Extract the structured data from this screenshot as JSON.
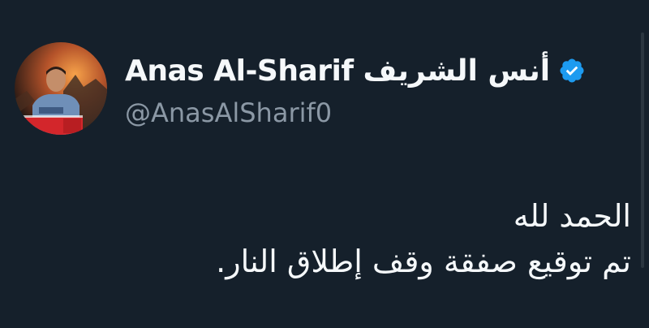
{
  "user": {
    "display_name": "Anas Al-Sharif أنس الشريف",
    "handle": "@AnasAlSharif0",
    "verified": true,
    "avatar_badge_text": "PRESS"
  },
  "tweet": {
    "lines": [
      "الحمد لله",
      "تم توقيع صفقة وقف إطلاق النار."
    ]
  },
  "colors": {
    "background": "#15202b",
    "name": "#f5f8fa",
    "handle": "#8b98a5",
    "verified": "#1d9bf0"
  }
}
